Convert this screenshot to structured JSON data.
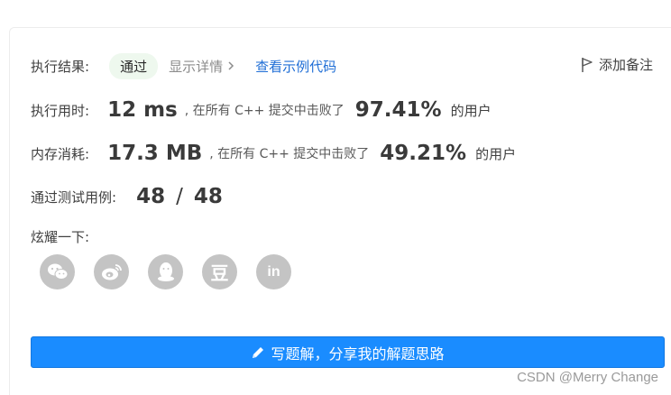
{
  "result": {
    "label": "执行结果:",
    "status": "通过",
    "details_link": "显示详情",
    "example_link": "查看示例代码",
    "add_note": "添加备注"
  },
  "runtime": {
    "label": "执行用时:",
    "value": "12 ms",
    "beat_prefix": ", 在所有 C++ 提交中击败了",
    "percent": "97.41%",
    "suffix": "的用户"
  },
  "memory": {
    "label": "内存消耗:",
    "value": "17.3 MB",
    "beat_prefix": ", 在所有 C++ 提交中击败了",
    "percent": "49.21%",
    "suffix": "的用户"
  },
  "tests": {
    "label": "通过测试用例:",
    "passed": "48",
    "separator": "/",
    "total": "48"
  },
  "share": {
    "label": "炫耀一下:",
    "icons": [
      "wechat-icon",
      "weibo-icon",
      "qq-icon",
      "douban-icon",
      "linkedin-icon"
    ],
    "douban_glyph": "豆",
    "linkedin_glyph": "in"
  },
  "write_solution": {
    "label": "写题解，分享我的解题思路"
  },
  "watermark": "CSDN @Merry Change",
  "colors": {
    "accent_blue": "#1a8cff",
    "link_blue": "#1f6ed6",
    "pass_bg": "#eef8ee",
    "icon_gray": "#c4c4c4"
  }
}
